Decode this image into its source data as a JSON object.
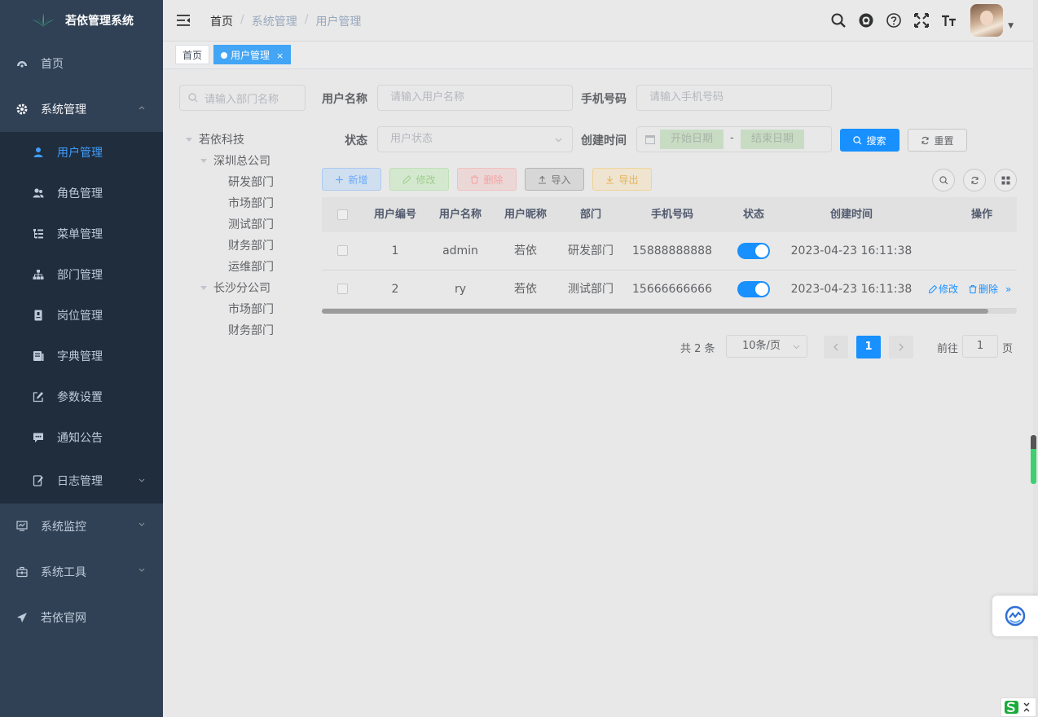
{
  "sidebar": {
    "app_title": "若依管理系统",
    "menu": {
      "home": "首页",
      "system": "系统管理",
      "system_children": [
        "用户管理",
        "角色管理",
        "菜单管理",
        "部门管理",
        "岗位管理",
        "字典管理",
        "参数设置",
        "通知公告",
        "日志管理"
      ],
      "monitor": "系统监控",
      "tools": "系统工具",
      "website": "若依官网"
    },
    "active_item": "用户管理"
  },
  "navbar": {
    "breadcrumb": [
      "首页",
      "系统管理",
      "用户管理"
    ],
    "separator": "/",
    "icons": [
      "search-icon",
      "github-icon",
      "question-icon",
      "fullscreen-icon",
      "font-size-icon"
    ],
    "avatar_caret": "▼"
  },
  "tags": {
    "home": "首页",
    "active": "用户管理",
    "close": "×"
  },
  "dept": {
    "search_placeholder": "请输入部门名称",
    "tree": {
      "root": "若依科技",
      "branches": [
        {
          "label": "深圳总公司",
          "children": [
            "研发部门",
            "市场部门",
            "测试部门",
            "财务部门",
            "运维部门"
          ]
        },
        {
          "label": "长沙分公司",
          "children": [
            "市场部门",
            "财务部门"
          ]
        }
      ]
    }
  },
  "search_form": {
    "username_label": "用户名称",
    "username_placeholder": "请输入用户名称",
    "phone_label": "手机号码",
    "phone_placeholder": "请输入手机号码",
    "status_label": "状态",
    "status_placeholder": "用户状态",
    "created_label": "创建时间",
    "start_placeholder": "开始日期",
    "range_separator": "-",
    "end_placeholder": "结束日期",
    "search_button": "搜索",
    "reset_button": "重置"
  },
  "toolbar": {
    "add": "新增",
    "edit": "修改",
    "delete": "删除",
    "import": "导入",
    "export": "导出"
  },
  "table": {
    "columns": [
      "用户编号",
      "用户名称",
      "用户昵称",
      "部门",
      "手机号码",
      "状态",
      "创建时间",
      "操作"
    ],
    "rows": [
      {
        "id": "1",
        "username": "admin",
        "nickname": "若依",
        "dept": "研发部门",
        "phone": "15888888888",
        "status_on": true,
        "created": "2023-04-23 16:11:38"
      },
      {
        "id": "2",
        "username": "ry",
        "nickname": "若依",
        "dept": "测试部门",
        "phone": "15666666666",
        "status_on": true,
        "created": "2023-04-23 16:11:38"
      }
    ],
    "row_actions": {
      "edit": "修改",
      "delete": "删除",
      "more": "»"
    }
  },
  "pagination": {
    "total_text": "共 2 条",
    "page_size": "10条/页",
    "current_page": "1",
    "goto_label": "前往",
    "goto_value": "1",
    "goto_unit": "页"
  },
  "colors": {
    "sidebar_bg": "#304156",
    "submenu_bg": "#1f2d3d",
    "accent": "#1890ff",
    "active_text": "#409eff"
  }
}
